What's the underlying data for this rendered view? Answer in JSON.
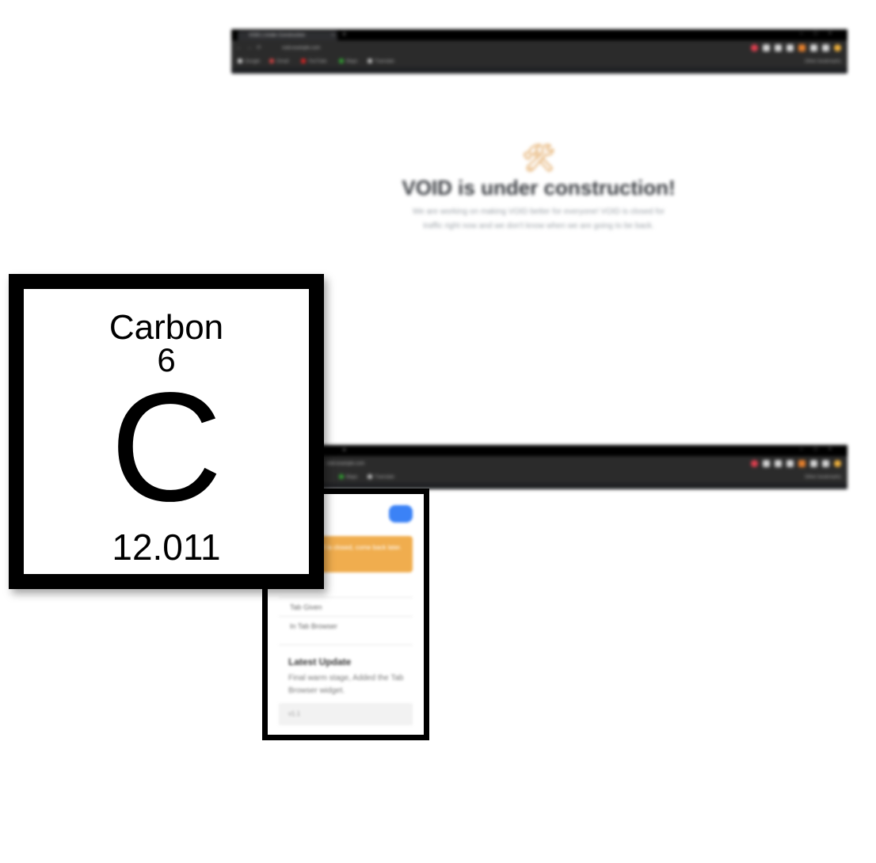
{
  "top_browser": {
    "tab_title": "VOID | Under Construction",
    "url": "void.example.com",
    "bookmarks": [
      "Google",
      "Gmail",
      "YouTube",
      "Maps",
      "Translate"
    ],
    "other_bookmarks": "Other bookmarks"
  },
  "bottom_browser": {
    "url": "void.example.com",
    "bookmarks": [
      "Maps",
      "Translate"
    ],
    "other_bookmarks": "Other bookmarks"
  },
  "construction": {
    "icon": "hammer-and-wrench-icon",
    "icon_glyph": "🛠",
    "title": "VOID is under construction!",
    "subtitle_line1": "We are working on making VOID better for everyone! VOID is closed for",
    "subtitle_line2": "traffic right now and we don't know when we are going to be back."
  },
  "mobile": {
    "banner_text": "VOID is closed, come back later.",
    "row1": "Tab Given",
    "row2": "In Tab Browser",
    "update_title": "Latest Update",
    "update_text": "Final warm stage, Added the Tab Browser widget.",
    "footer": "v1.1"
  },
  "element": {
    "name": "Carbon",
    "atomic_number": "6",
    "symbol": "C",
    "atomic_mass": "12.011"
  },
  "colors": {
    "accent_blue": "#3b82f6",
    "banner_orange": "#f0ad4e",
    "title_dark": "#3a3d42"
  }
}
